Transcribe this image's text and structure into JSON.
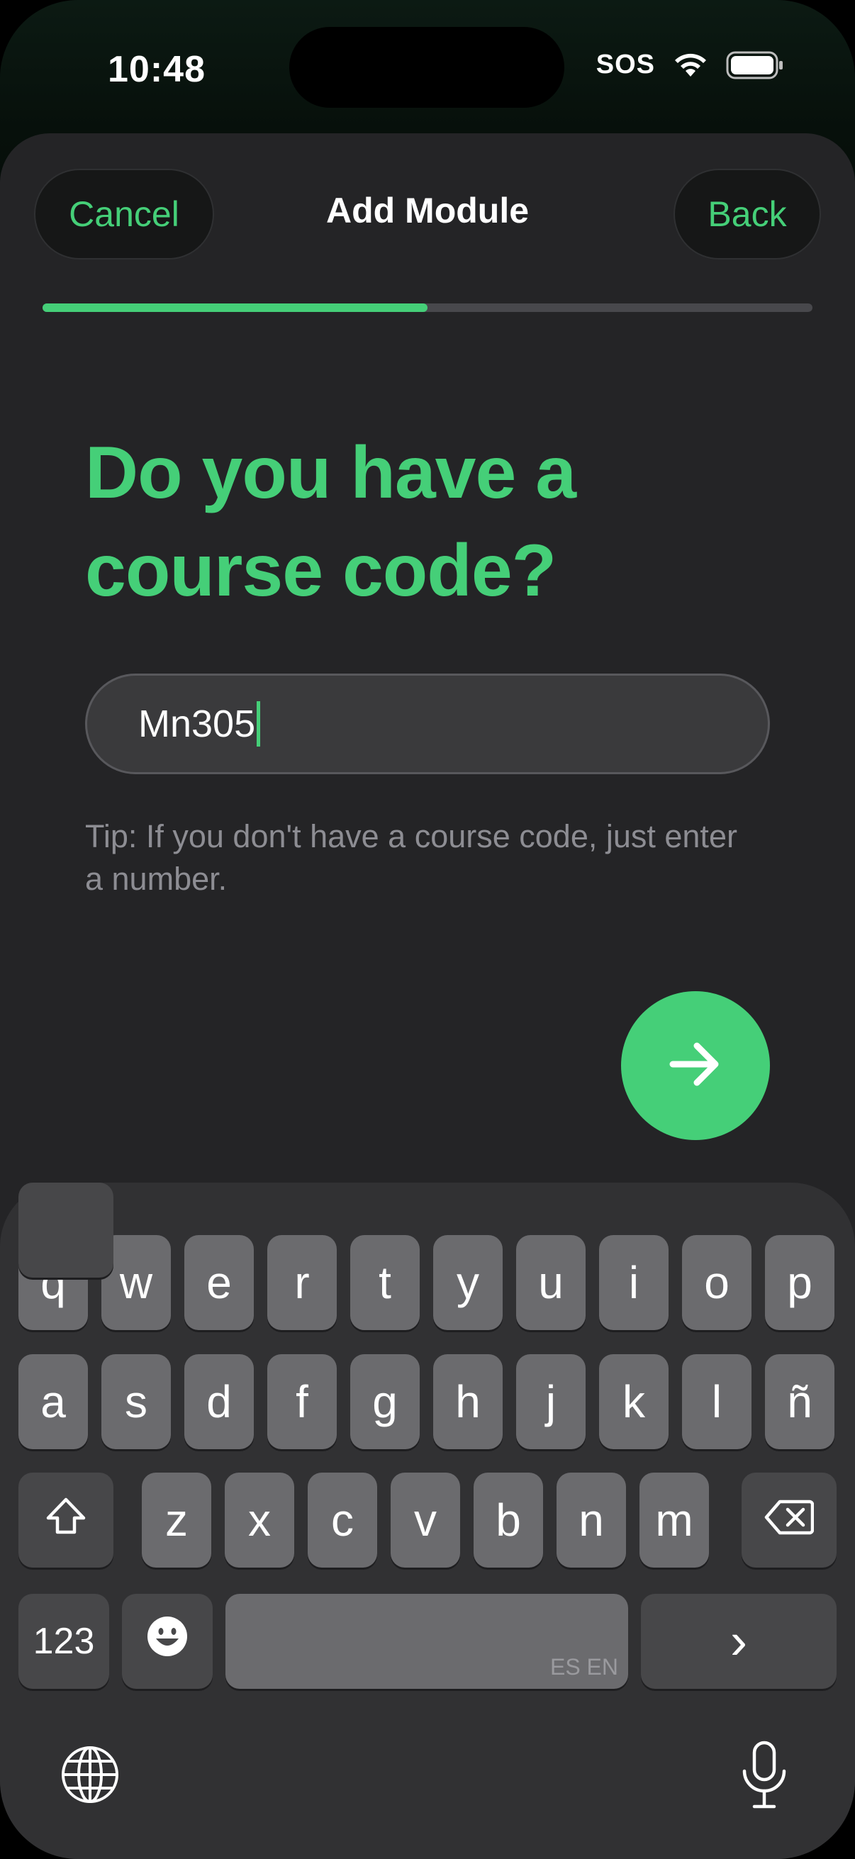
{
  "status_bar": {
    "time": "10:48",
    "carrier": "SOS",
    "icons": [
      "wifi-icon",
      "battery-icon"
    ]
  },
  "nav": {
    "cancel_label": "Cancel",
    "title": "Add Module",
    "back_label": "Back"
  },
  "progress": {
    "fraction": 0.5
  },
  "question": {
    "line1": "Do you have a",
    "line2": "course code?"
  },
  "code_input": {
    "value": "Mn305"
  },
  "tip": "Tip: If you don't have a course code, just enter a number.",
  "next_button": {
    "icon": "arrow-right-icon"
  },
  "keyboard": {
    "row1": [
      "q",
      "w",
      "e",
      "r",
      "t",
      "y",
      "u",
      "i",
      "o",
      "p"
    ],
    "row2": [
      "a",
      "s",
      "d",
      "f",
      "g",
      "h",
      "j",
      "k",
      "l",
      "ñ"
    ],
    "row3": [
      "z",
      "x",
      "c",
      "v",
      "b",
      "n",
      "m"
    ],
    "numbers_label": "123",
    "space_lang": "ES EN",
    "return_symbol": "›",
    "icons": [
      "shift-icon",
      "delete-icon",
      "emoji-icon",
      "globe-icon",
      "microphone-icon"
    ]
  },
  "colors": {
    "accent": "#45cf78",
    "sheet_background": "#242426",
    "keyboard_background": "#313133"
  }
}
